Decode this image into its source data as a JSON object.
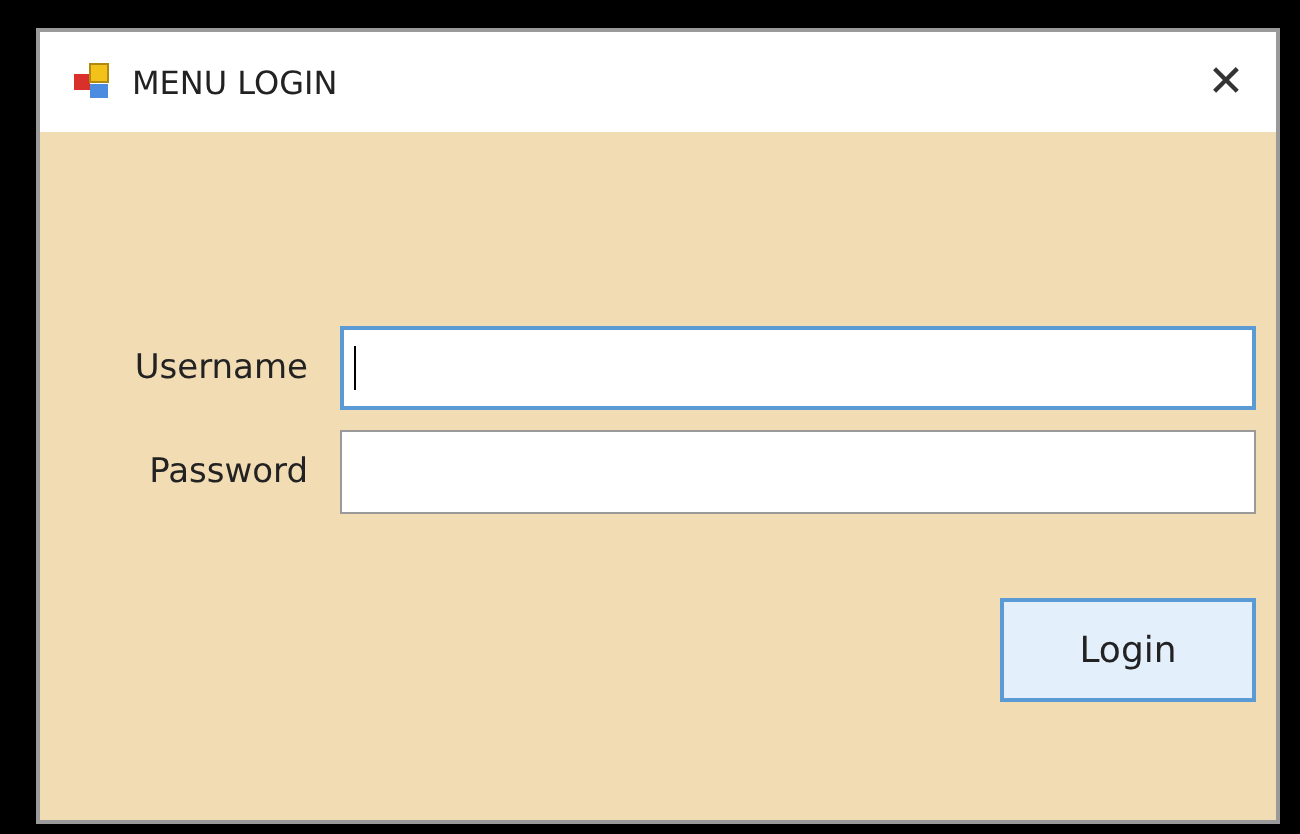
{
  "window": {
    "title": "MENU LOGIN",
    "close": "✕"
  },
  "fields": [
    {
      "label": "Username",
      "focused": true
    },
    {
      "label": "Password",
      "focused": false
    }
  ],
  "buttons": [
    {
      "label": "Login"
    }
  ]
}
